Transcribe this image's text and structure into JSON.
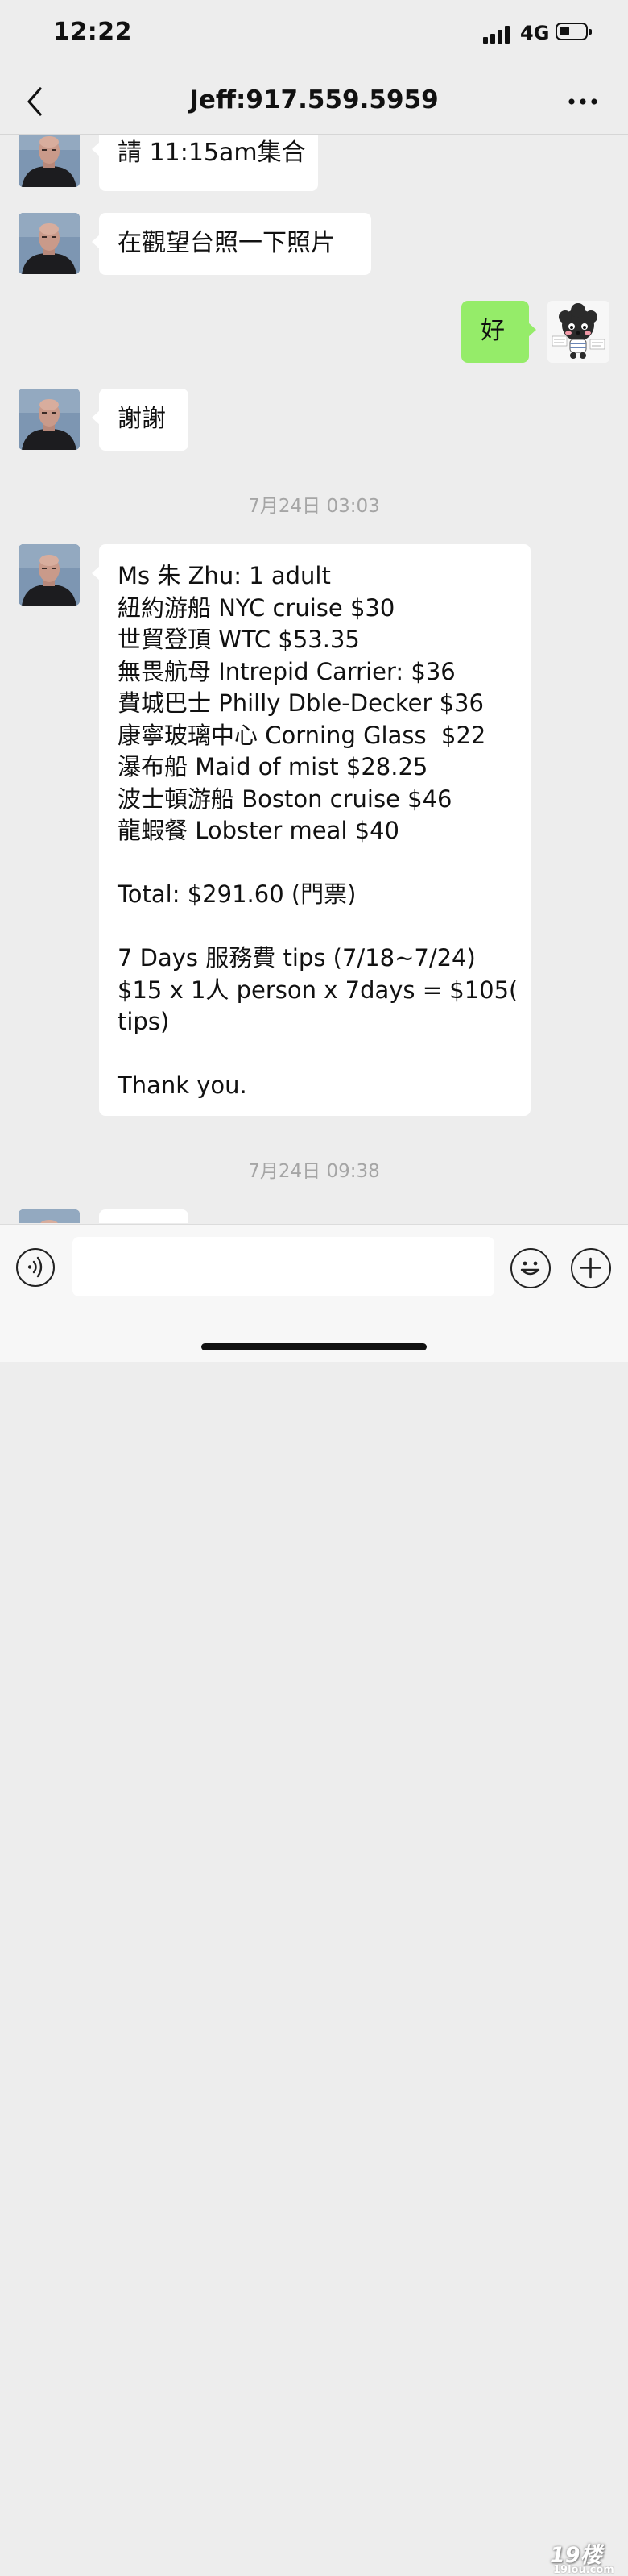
{
  "status_bar": {
    "time": "12:22",
    "network": "4G"
  },
  "nav": {
    "title": "Jeff:917.559.5959"
  },
  "messages": {
    "m1": "請 11:15am集合",
    "m2": "在觀望台照一下照片",
    "m3": "好",
    "m4": "謝謝",
    "time1": "7月24日 03:03",
    "long_lines": [
      "Ms 朱 Zhu: 1 adult",
      "紐約游船 NYC cruise $30",
      "世貿登頂 WTC $53.35",
      "無畏航母 Intrepid Carrier: $36",
      "費城巴士 Philly Dble-Decker $36",
      "康寧玻璃中心 Corning Glass  $22",
      "瀑布船 Maid of mist $28.25",
      "波士頓游船 Boston cruise $46",
      "龍蝦餐 Lobster meal $40",
      "",
      "Total: $291.60 (門票)",
      "",
      "7 Days 服務費 tips (7/18~7/24)",
      "$15 x 1人 person x 7days = $105(",
      "tips)",
      "",
      "Thank you."
    ],
    "time2": "7月24日 09:38"
  },
  "watermark": {
    "logo": "19楼",
    "domain": "19lou.com"
  },
  "colors": {
    "background": "#ededed",
    "sent_bubble": "#95ec69",
    "received_bubble": "#ffffff",
    "timestamp": "#a5a5a5"
  }
}
